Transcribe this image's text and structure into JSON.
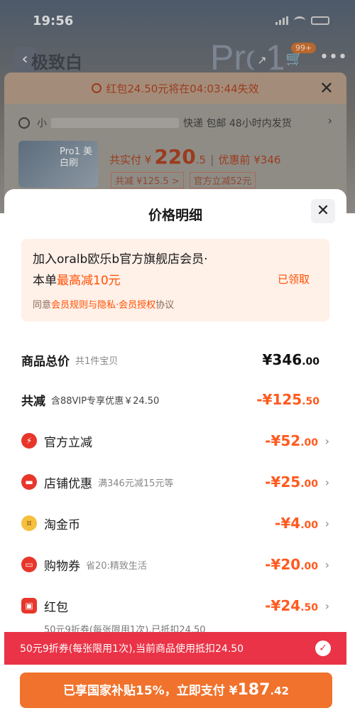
{
  "status_bar": {
    "time": "19:56"
  },
  "background": {
    "title": "极致白",
    "brand_text": "Pro1",
    "cart_badge": "99+",
    "timer_text": "红包24.50元将在04:03:44失效",
    "address": {
      "prefix": "小",
      "shipping": "快递 包邮 48小时内发货"
    },
    "product_thumb_text": "Pro1 美白刷",
    "price": {
      "label": "共实付 ¥",
      "main": "220",
      "decimal": ".5",
      "before_label": "优惠前 ¥346"
    },
    "tags": [
      "共减 ¥125.5 >",
      "官方立减52元"
    ]
  },
  "sheet": {
    "title": "价格明细",
    "member": {
      "line1": "加入oralb欧乐b官方旗舰店会员·",
      "line2_prefix": "本单",
      "line2_highlight": "最高减10元",
      "claimed": "已领取",
      "agree_prefix": "同意",
      "agree_link": "会员规则与隐私·会员授权",
      "agree_suffix": "协议"
    },
    "rows": {
      "total": {
        "name": "商品总价",
        "sub": "共1件宝贝",
        "int": "¥346",
        "dec": ".00"
      },
      "reduce": {
        "name": "共减",
        "sub": "含88VIP专享优惠￥24.50",
        "int": "-¥125",
        "dec": ".50"
      },
      "official": {
        "name": "官方立减",
        "sub": "",
        "int": "-¥52",
        "dec": ".00"
      },
      "shop": {
        "name": "店铺优惠",
        "sub": "满346元减15元等",
        "int": "-¥25",
        "dec": ".00"
      },
      "coin": {
        "name": "淘金币",
        "sub": "",
        "int": "-¥4",
        "dec": ".00"
      },
      "voucher": {
        "name": "购物券",
        "sub": "省20:精致生活",
        "int": "-¥20",
        "dec": ".00"
      },
      "hongbao": {
        "name": "红包",
        "sub": "",
        "int": "-¥24",
        "dec": ".50"
      }
    },
    "hongbao_note": "50元9折券(每张限用1次),已抵扣24.50"
  },
  "red_bar": {
    "text": "50元9折券(每张限用1次),当前商品使用抵扣24.50"
  },
  "pay_button": {
    "prefix": "已享国家补贴15%，立即支付 ¥",
    "int": "187",
    "dec": ".42"
  },
  "colors": {
    "accent": "#ff5000",
    "red_bar": "#ea3347",
    "pay_button": "#f0722c"
  }
}
